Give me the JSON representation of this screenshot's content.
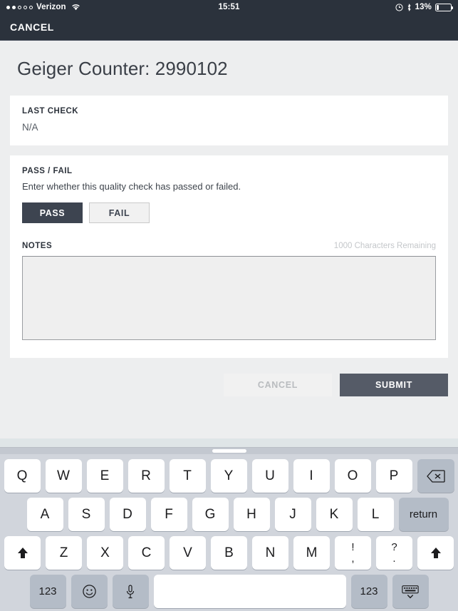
{
  "statusbar": {
    "carrier": "Verizon",
    "signal_filled": 2,
    "signal_total": 5,
    "wifi_icon": "wifi-icon",
    "time": "15:51",
    "alarm_icon": "alarm-clock-icon",
    "bluetooth_icon": "bluetooth-icon",
    "battery_percent": "13%",
    "battery_icon": "battery-icon"
  },
  "navbar": {
    "cancel_label": "CANCEL"
  },
  "page": {
    "title": "Geiger Counter: 2990102"
  },
  "last_check": {
    "label": "LAST CHECK",
    "value": "N/A"
  },
  "pass_fail": {
    "label": "PASS / FAIL",
    "description": "Enter whether this quality check has passed or failed.",
    "pass_label": "PASS",
    "fail_label": "FAIL",
    "selected": "PASS"
  },
  "notes": {
    "label": "NOTES",
    "characters_remaining": "1000 Characters Remaining",
    "value": "",
    "placeholder": ""
  },
  "actions": {
    "cancel_label": "CANCEL",
    "cancel_disabled": true,
    "submit_label": "SUBMIT"
  },
  "keyboard": {
    "handle_icon": "drag-handle-icon",
    "row1": [
      "Q",
      "W",
      "E",
      "R",
      "T",
      "Y",
      "U",
      "I",
      "O",
      "P"
    ],
    "backspace_icon": "backspace-icon",
    "row2": [
      "A",
      "S",
      "D",
      "F",
      "G",
      "H",
      "J",
      "K",
      "L"
    ],
    "return_label": "return",
    "row3": [
      "Z",
      "X",
      "C",
      "V",
      "B",
      "N",
      "M"
    ],
    "shift_icon": "shift-icon",
    "punct1_top": "!",
    "punct1_bottom": ",",
    "punct2_top": "?",
    "punct2_bottom": ".",
    "numeric_label": "123",
    "emoji_icon": "emoji-icon",
    "mic_icon": "microphone-icon",
    "space_label": "",
    "hide_keyboard_icon": "hide-keyboard-icon"
  },
  "colors": {
    "navbar_bg": "#2b323c",
    "accent_dark": "#3d4450",
    "submit_bg": "#555b67",
    "page_bg": "#edeeef",
    "keyboard_bg": "#d1d5dc"
  }
}
